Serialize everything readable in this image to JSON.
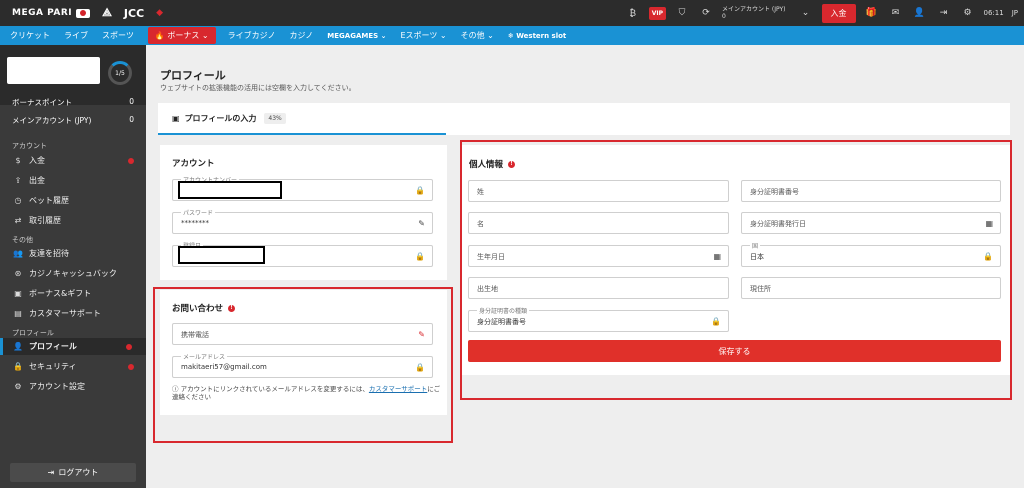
{
  "topbar": {
    "logo": "MEGA PARI",
    "partner": "JCC",
    "account_label": "メインアカウント (JPY)",
    "account_value": "0",
    "deposit_button": "入金",
    "vip": "VIP",
    "time": "06:11",
    "language": "JP"
  },
  "nav": {
    "items": [
      "クリケット",
      "ライブ",
      "スポーツ",
      "ボーナス",
      "ライブカジノ",
      "カジノ",
      "MEGAGAMES",
      "Eスポーツ",
      "その他",
      "Western slot"
    ]
  },
  "sidebar": {
    "level": "1/5",
    "bonus_points_label": "ボーナスポイント",
    "bonus_points_value": "0",
    "main_account_label": "メインアカウント (JPY)",
    "main_account_value": "0",
    "section_account": "アカウント",
    "deposit": "入金",
    "withdraw": "出金",
    "bet_history": "ベット履歴",
    "transaction_history": "取引履歴",
    "section_other": "その他",
    "invite_friends": "友達を招待",
    "cashback": "カジノキャッシュバック",
    "bonus_gift": "ボーナス&ギフト",
    "support": "カスタマーサポート",
    "section_profile": "プロフィール",
    "profile": "プロフィール",
    "security": "セキュリティ",
    "account_settings": "アカウント設定",
    "logout": "ログアウト"
  },
  "main": {
    "title": "プロフィール",
    "subtitle": "ウェブサイトの拡張機能の活用には空欄を入力してください。",
    "tab_label": "プロフィールの入力",
    "tab_percent": "43%"
  },
  "account_card": {
    "title": "アカウント",
    "account_number_label": "アカウントナンバー",
    "password_label": "パスワード",
    "password_value": "********",
    "promo_code_label": "登録日"
  },
  "contact_card": {
    "title": "お問い合わせ",
    "phone_placeholder": "携帯電話",
    "email_label": "メールアドレス",
    "email_value": "makitaeri57@gmail.com",
    "note_text": "アカウントにリンクされているメールアドレスを変更するには、",
    "note_link": "カスタマーサポート",
    "note_suffix": "にご連絡ください"
  },
  "personal_card": {
    "title": "個人情報",
    "last_name": "姓",
    "id_number": "身分証明書番号",
    "first_name": "名",
    "id_issue_date": "身分証明書発行日",
    "birth_date": "生年月日",
    "country_label": "国",
    "country_value": "日本",
    "birth_place": "出生地",
    "address": "現住所",
    "id_type_label": "身分証明書の種類",
    "id_type_value": "身分証明書番号",
    "save_button": "保存する"
  }
}
